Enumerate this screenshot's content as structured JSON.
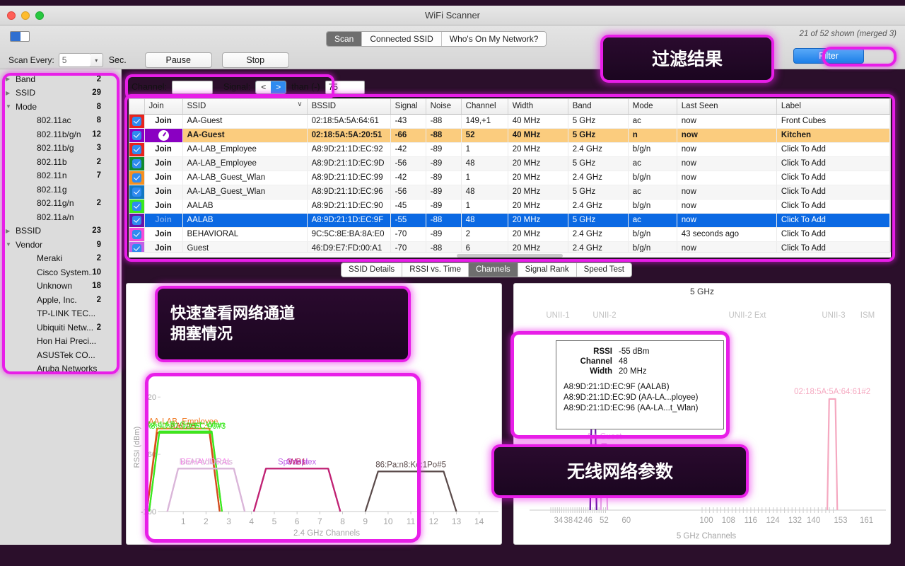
{
  "window": {
    "title": "WiFi Scanner"
  },
  "toolbar": {
    "tabs": [
      {
        "label": "Scan",
        "active": true
      },
      {
        "label": "Connected SSID",
        "active": false
      },
      {
        "label": "Who's On My Network?",
        "active": false
      }
    ],
    "shown_status": "21 of 52 shown (merged 3)",
    "filter_button": "Filter",
    "scan_every_label": "Scan Every:",
    "scan_interval": "5",
    "sec_label": "Sec.",
    "pause_label": "Pause",
    "stop_label": "Stop"
  },
  "filterbar": {
    "channel_label": "Channel:",
    "channel_value": "",
    "signal_label": "Signal:",
    "op_less": "<",
    "op_greater": ">",
    "than_label": "than (-)",
    "threshold": "75"
  },
  "sidebar": {
    "items": [
      {
        "label": "Band",
        "count": "2",
        "arrow": "▶",
        "child": false
      },
      {
        "label": "SSID",
        "count": "29",
        "arrow": "▶",
        "child": false
      },
      {
        "label": "Mode",
        "count": "8",
        "arrow": "▼",
        "child": false
      },
      {
        "label": "802.11ac",
        "count": "8",
        "arrow": "",
        "child": true
      },
      {
        "label": "802.11b/g/n",
        "count": "12",
        "arrow": "",
        "child": true
      },
      {
        "label": "802.11b/g",
        "count": "3",
        "arrow": "",
        "child": true
      },
      {
        "label": "802.11b",
        "count": "2",
        "arrow": "",
        "child": true
      },
      {
        "label": "802.11n",
        "count": "7",
        "arrow": "",
        "child": true
      },
      {
        "label": "802.11g",
        "count": "",
        "arrow": "",
        "child": true
      },
      {
        "label": "802.11g/n",
        "count": "2",
        "arrow": "",
        "child": true
      },
      {
        "label": "802.11a/n",
        "count": "",
        "arrow": "",
        "child": true
      },
      {
        "label": "BSSID",
        "count": "23",
        "arrow": "▶",
        "child": false
      },
      {
        "label": "Vendor",
        "count": "9",
        "arrow": "▼",
        "child": false
      },
      {
        "label": "Meraki",
        "count": "2",
        "arrow": "",
        "child": true
      },
      {
        "label": "Cisco System...",
        "count": "10",
        "arrow": "",
        "child": true
      },
      {
        "label": "Unknown",
        "count": "18",
        "arrow": "",
        "child": true
      },
      {
        "label": "Apple, Inc.",
        "count": "2",
        "arrow": "",
        "child": true
      },
      {
        "label": "TP-LINK TEC...",
        "count": "",
        "arrow": "",
        "child": true
      },
      {
        "label": "Ubiquiti Netw...",
        "count": "2",
        "arrow": "",
        "child": true
      },
      {
        "label": "Hon Hai Preci...",
        "count": "",
        "arrow": "",
        "child": true
      },
      {
        "label": "ASUSTek CO...",
        "count": "",
        "arrow": "",
        "child": true
      },
      {
        "label": "Aruba Networks",
        "count": "",
        "arrow": "",
        "child": true
      }
    ]
  },
  "table": {
    "columns": [
      "Join",
      "SSID",
      "BSSID",
      "Signal",
      "Noise",
      "Channel",
      "Width",
      "Band",
      "Mode",
      "Last Seen",
      "Label"
    ],
    "sort_indicator": "∨",
    "join_label": "Join",
    "label_placeholder": "Click To Add",
    "rows": [
      {
        "color": "#e8231c",
        "join": "Join",
        "ssid": "AA-Guest",
        "bssid": "02:18:5A:5A:64:61",
        "signal": "-43",
        "noise": "-88",
        "channel": "149,+1",
        "width": "40 MHz",
        "band": "5 GHz",
        "mode": "ac",
        "last_seen": "now",
        "label": "Front Cubes",
        "state": "normal"
      },
      {
        "color": "#8a00c2",
        "join": "",
        "ssid": "AA-Guest",
        "bssid": "02:18:5A:5A:20:51",
        "signal": "-66",
        "noise": "-88",
        "channel": "52",
        "width": "40 MHz",
        "band": "5 GHz",
        "mode": "n",
        "last_seen": "now",
        "label": "Kitchen",
        "state": "highlight"
      },
      {
        "color": "#e8231c",
        "join": "Join",
        "ssid": "AA-LAB_Employee",
        "bssid": "A8:9D:21:1D:EC:92",
        "signal": "-42",
        "noise": "-89",
        "channel": "1",
        "width": "20 MHz",
        "band": "2.4 GHz",
        "mode": "b/g/n",
        "last_seen": "now",
        "label": "",
        "state": "normal"
      },
      {
        "color": "#128a2f",
        "join": "Join",
        "ssid": "AA-LAB_Employee",
        "bssid": "A8:9D:21:1D:EC:9D",
        "signal": "-56",
        "noise": "-89",
        "channel": "48",
        "width": "20 MHz",
        "band": "5 GHz",
        "mode": "ac",
        "last_seen": "now",
        "label": "",
        "state": "alt"
      },
      {
        "color": "#f59021",
        "join": "Join",
        "ssid": "AA-LAB_Guest_Wlan",
        "bssid": "A8:9D:21:1D:EC:99",
        "signal": "-42",
        "noise": "-89",
        "channel": "1",
        "width": "20 MHz",
        "band": "2.4 GHz",
        "mode": "b/g/n",
        "last_seen": "now",
        "label": "",
        "state": "normal"
      },
      {
        "color": "#1277c2",
        "join": "Join",
        "ssid": "AA-LAB_Guest_Wlan",
        "bssid": "A8:9D:21:1D:EC:96",
        "signal": "-56",
        "noise": "-89",
        "channel": "48",
        "width": "20 MHz",
        "band": "5 GHz",
        "mode": "ac",
        "last_seen": "now",
        "label": "",
        "state": "alt"
      },
      {
        "color": "#3ae81e",
        "join": "Join",
        "ssid": "AALAB",
        "bssid": "A8:9D:21:1D:EC:90",
        "signal": "-45",
        "noise": "-89",
        "channel": "1",
        "width": "20 MHz",
        "band": "2.4 GHz",
        "mode": "b/g/n",
        "last_seen": "now",
        "label": "",
        "state": "normal"
      },
      {
        "color": "#6a12a8",
        "join": "Join",
        "ssid": "AALAB",
        "bssid": "A8:9D:21:1D:EC:9F",
        "signal": "-55",
        "noise": "-88",
        "channel": "48",
        "width": "20 MHz",
        "band": "5 GHz",
        "mode": "ac",
        "last_seen": "now",
        "label": "",
        "state": "selected"
      },
      {
        "color": "#f54cd8",
        "join": "Join",
        "ssid": "BEHAVIORAL",
        "bssid": "9C:5C:8E:BA:8A:E0",
        "signal": "-70",
        "noise": "-89",
        "channel": "2",
        "width": "20 MHz",
        "band": "2.4 GHz",
        "mode": "b/g/n",
        "last_seen": "43 seconds ago",
        "label": "",
        "state": "normal"
      },
      {
        "color": "#c060e8",
        "join": "Join",
        "ssid": "Guest",
        "bssid": "46:D9:E7:FD:00:A1",
        "signal": "-70",
        "noise": "-88",
        "channel": "6",
        "width": "20 MHz",
        "band": "2.4 GHz",
        "mode": "b/g/n",
        "last_seen": "now",
        "label": "",
        "state": "alt"
      }
    ]
  },
  "chart_tabs": [
    {
      "label": "SSID Details",
      "active": false
    },
    {
      "label": "RSSI vs. Time",
      "active": false
    },
    {
      "label": "Channels",
      "active": true
    },
    {
      "label": "Signal Rank",
      "active": false
    },
    {
      "label": "Speed Test",
      "active": false
    }
  ],
  "tooltip": {
    "rssi_key": "RSSI",
    "rssi_value": "-55 dBm",
    "channel_key": "Channel",
    "channel_value": "48",
    "width_key": "Width",
    "width_value": "20 MHz",
    "entries": [
      "A8:9D:21:1D:EC:9F  (AALAB)",
      "A8:9D:21:1D:EC:9D  (AA-LA...ployee)",
      "A8:9D:21:1D:EC:96  (AA-LA...t_Wlan)"
    ]
  },
  "annotations": [
    {
      "id": "filter",
      "lines": [
        "过滤结果"
      ]
    },
    {
      "id": "channels",
      "lines": [
        "快速查看网络通道",
        "拥塞情况"
      ]
    },
    {
      "id": "params",
      "lines": [
        "无线网络参数"
      ]
    }
  ],
  "chart_data": [
    {
      "type": "area",
      "id": "chart-24ghz",
      "title": "",
      "xlabel": "2.4 GHz Channels",
      "ylabel": "RSSI (dBm)",
      "xlim": [
        0,
        14.6
      ],
      "ylim": [
        -100,
        -10
      ],
      "xticks": [
        "1",
        "2",
        "3",
        "4",
        "5",
        "6",
        "7",
        "8",
        "9",
        "10",
        "11",
        "12",
        "13",
        "14"
      ],
      "yticks": [
        "-20",
        "-60",
        "-100"
      ],
      "grid": false,
      "series": [
        {
          "name": "AA-LAB_Employee",
          "label": "AA-LAB_Employee",
          "color": "#f07820",
          "center": 1,
          "peak": -42,
          "floor": -100,
          "halfwidth": 1.6
        },
        {
          "name": "AALAB",
          "label": "AALAB",
          "color": "#d24a1e",
          "center": 1,
          "peak": -45,
          "floor": -100,
          "halfwidth": 1.6
        },
        {
          "name": "AA-LAB_Guest_Wlan",
          "label": "AA-LAB_Guest_Wlan",
          "color": "#3ae81e",
          "center": 1.1,
          "peak": -44,
          "floor": -100,
          "halfwidth": 1.6
        },
        {
          "name": "A8:9D:21:1D:EC:90#3",
          "label": "A8:9D:21:1D:EC:90#3",
          "color": "#3ae81e",
          "center": 1.1,
          "peak": -45,
          "floor": -100,
          "halfwidth": 1.6
        },
        {
          "name": "BEHAVIORAL",
          "label": "BEHAVIORAL",
          "color": "#f581e8",
          "center": 2,
          "peak": -70,
          "floor": -100,
          "halfwidth": 1.7
        },
        {
          "name": "NuAPsolutions",
          "label": "NuAPsolutions",
          "color": "#d8b8d8",
          "center": 2,
          "peak": -70,
          "floor": -100,
          "halfwidth": 1.7
        },
        {
          "name": "Guest",
          "label": "Guest",
          "color": "#b83cd8",
          "center": 6,
          "peak": -70,
          "floor": -100,
          "halfwidth": 1.9
        },
        {
          "name": "Sportsplex",
          "label": "Sportsplex",
          "color": "#c060e8",
          "center": 6,
          "peak": -70,
          "floor": -100,
          "halfwidth": 1.9
        },
        {
          "name": "WB1",
          "label": "WB1",
          "color": "#c2246e",
          "center": 6,
          "peak": -70,
          "floor": -100,
          "halfwidth": 1.9
        },
        {
          "name": "86:Pa:n8:Ke:1P:o#5",
          "label": "86:Pa:n8:Ke:1Po#5",
          "color": "#5a4a4a",
          "center": 11,
          "peak": -72,
          "floor": -100,
          "halfwidth": 2.0
        }
      ]
    },
    {
      "type": "area",
      "id": "chart-5ghz",
      "title": "5 GHz",
      "xlabel": "5 GHz Channels",
      "ylabel": "",
      "xticks": [
        "34",
        "38",
        "42",
        "46",
        "52",
        "60",
        "100",
        "108",
        "116",
        "124",
        "132",
        "140",
        "153",
        "161"
      ],
      "bands": [
        "UNII-1",
        "UNII-2",
        "UNII-2 Ext",
        "UNII-3",
        "ISM"
      ],
      "grid": false,
      "series": [
        {
          "name": "A8:9D:21:1D:EC:9F",
          "label": "A8:9D:21:1D:EC:9F",
          "color": "#6a12a8",
          "center": 48,
          "peak": -55,
          "floor": -100,
          "halfwidth": 1.2
        },
        {
          "name": "AA-Guest",
          "label": "AA-Guest",
          "color": "#e7a8e7",
          "center": 52,
          "peak": -66,
          "floor": -100,
          "halfwidth": 1.2
        },
        {
          "name": "02:18:5A:5A:64:61#2",
          "label": "02:18:5A:5A:64:61#2",
          "color": "#f5a8c0",
          "center": 149,
          "peak": -43,
          "floor": -100,
          "halfwidth": 2.4
        }
      ]
    }
  ]
}
